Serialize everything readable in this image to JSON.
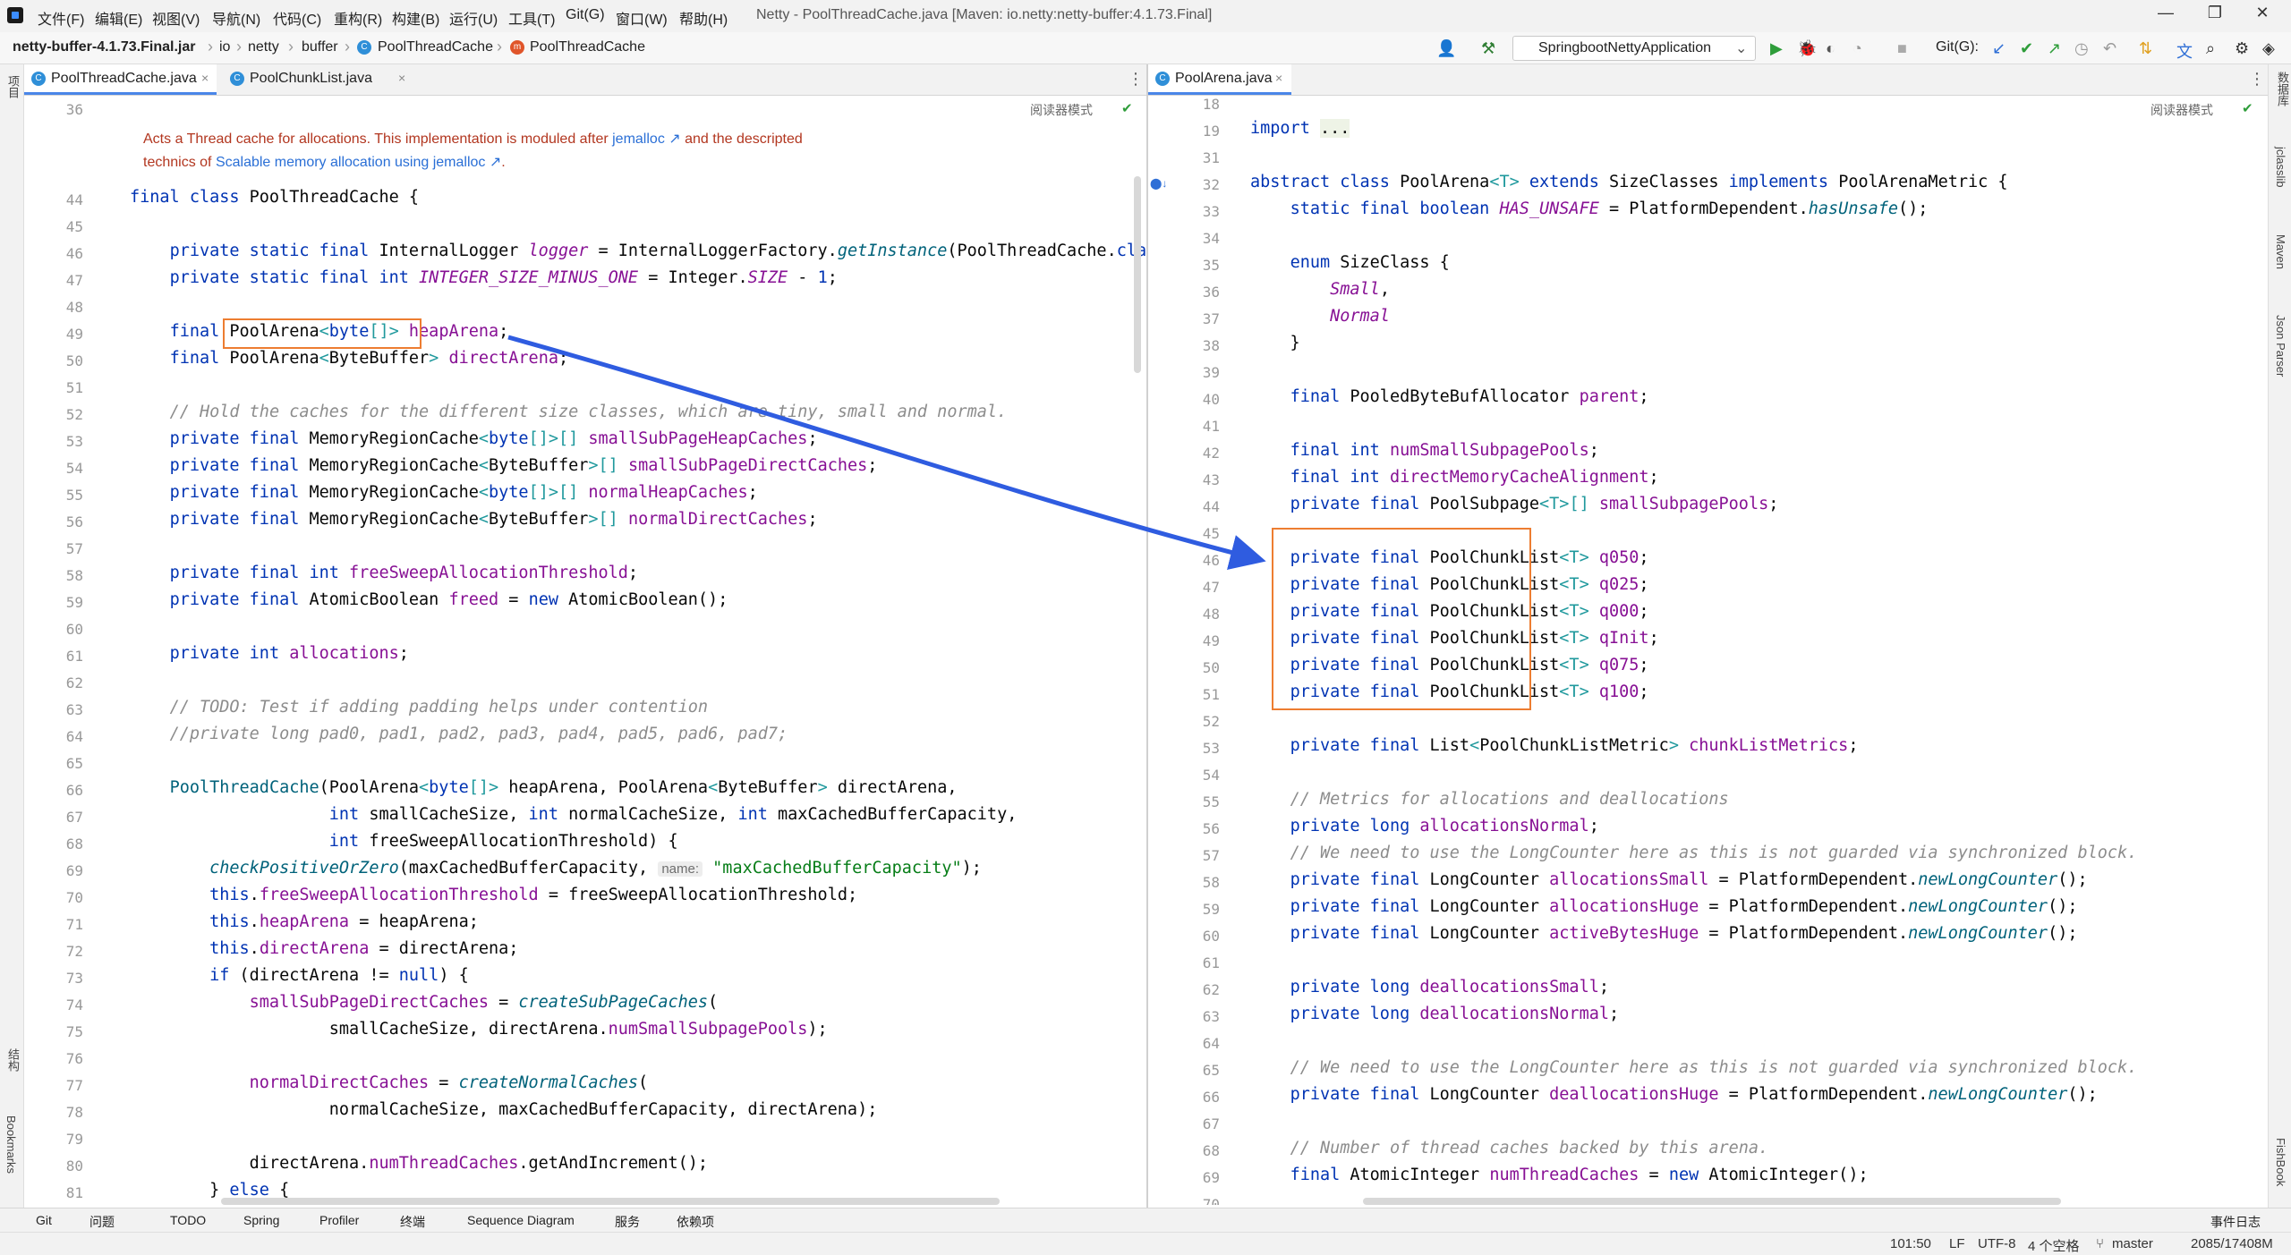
{
  "menu": [
    "文件(F)",
    "编辑(E)",
    "视图(V)",
    "导航(N)",
    "代码(C)",
    "重构(R)",
    "构建(B)",
    "运行(U)",
    "工具(T)",
    "Git(G)",
    "窗口(W)",
    "帮助(H)"
  ],
  "window_title": "Netty - PoolThreadCache.java [Maven: io.netty:netty-buffer:4.1.73.Final]",
  "breadcrumb": [
    "netty-buffer-4.1.73.Final.jar",
    "io",
    "netty",
    "buffer",
    "PoolThreadCache",
    "PoolThreadCache"
  ],
  "run_config": "SpringbootNettyApplication",
  "git_label": "Git(G):",
  "left_tabs": [
    "PoolThreadCache.java",
    "PoolChunkList.java"
  ],
  "right_tabs": [
    "PoolArena.java"
  ],
  "reader_mode": "阅读器模式",
  "left_strip": [
    "项目",
    "结构",
    "Bookmarks"
  ],
  "right_strip": [
    "数据库",
    "jclasslib",
    "Maven",
    "Json Parser",
    "FishBook"
  ],
  "left_doc": {
    "line1_pre": "Acts a Thread cache for allocations. This implementation is moduled after ",
    "line1_link": "jemalloc",
    "line1_post": " and the descripted",
    "line2_pre": "technics of ",
    "line2_link": "Scalable memory allocation using jemalloc",
    "line2_post": "."
  },
  "left_line_numbers": [
    "36",
    "44",
    "45",
    "46",
    "47",
    "48",
    "49",
    "50",
    "51",
    "52",
    "53",
    "54",
    "55",
    "56",
    "57",
    "58",
    "59",
    "60",
    "61",
    "62",
    "63",
    "64",
    "65",
    "66",
    "67",
    "68",
    "69",
    "70",
    "71",
    "72",
    "73",
    "74",
    "75",
    "76",
    "77",
    "78",
    "79",
    "80",
    "81"
  ],
  "right_line_numbers": [
    "18",
    "19",
    "31",
    "32",
    "33",
    "34",
    "35",
    "36",
    "37",
    "38",
    "39",
    "40",
    "41",
    "42",
    "43",
    "44",
    "45",
    "46",
    "47",
    "48",
    "49",
    "50",
    "51",
    "52",
    "53",
    "54",
    "55",
    "56",
    "57",
    "58",
    "59",
    "60",
    "61",
    "62",
    "63",
    "64",
    "65",
    "66",
    "67",
    "68",
    "69",
    "70"
  ],
  "bottom_tools": [
    "Git",
    "问题",
    "TODO",
    "Spring",
    "Profiler",
    "终端",
    "Sequence Diagram",
    "服务",
    "依赖项",
    "事件日志"
  ],
  "status": {
    "position": "101:50",
    "line_sep": "LF",
    "encoding": "UTF-8",
    "indent": "4 个空格",
    "branch": "master",
    "memory": "2085/17408M"
  }
}
